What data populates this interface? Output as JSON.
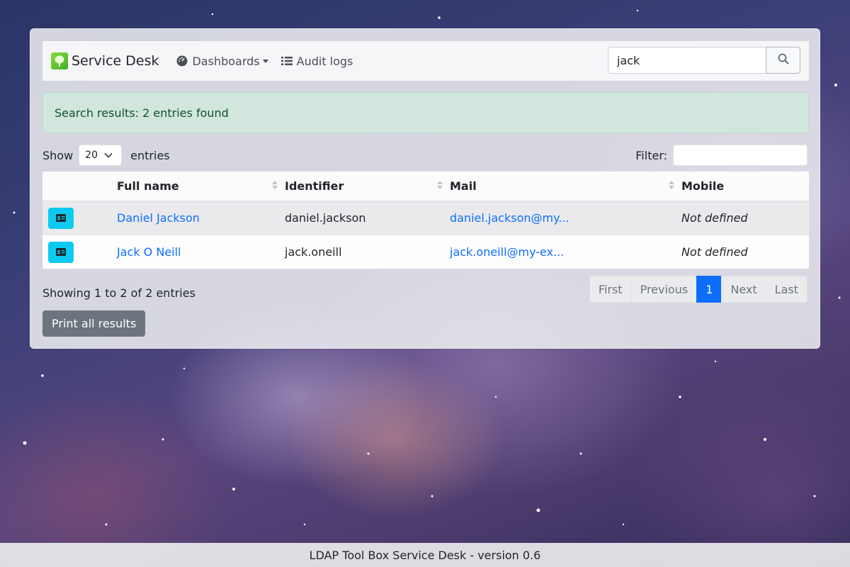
{
  "navbar": {
    "brand": "Service Desk",
    "dashboards_label": "Dashboards",
    "audit_label": "Audit logs",
    "search_value": "jack"
  },
  "alert": {
    "text": "Search results: 2 entries found"
  },
  "controls": {
    "show_label": "Show",
    "length_value": "20",
    "entries_label": "entries",
    "filter_label": "Filter:"
  },
  "table": {
    "headers": [
      "Full name",
      "Identifier",
      "Mail",
      "Mobile"
    ],
    "rows": [
      {
        "full_name": "Daniel Jackson",
        "identifier": "daniel.jackson",
        "mail": "daniel.jackson@my...",
        "mobile": "Not defined"
      },
      {
        "full_name": "Jack O Neill",
        "identifier": "jack.oneill",
        "mail": "jack.oneill@my-ex...",
        "mobile": "Not defined"
      }
    ]
  },
  "info": {
    "text": "Showing 1 to 2 of 2 entries"
  },
  "pagination": {
    "first": "First",
    "previous": "Previous",
    "current": "1",
    "next": "Next",
    "last": "Last"
  },
  "print_label": "Print all results",
  "footer": {
    "text": "LDAP Tool Box Service Desk - version 0.6"
  },
  "colors": {
    "primary": "#0d6efd",
    "info": "#0dcaf0",
    "alert_bg": "#d1e7dd",
    "secondary": "#6c757d"
  }
}
